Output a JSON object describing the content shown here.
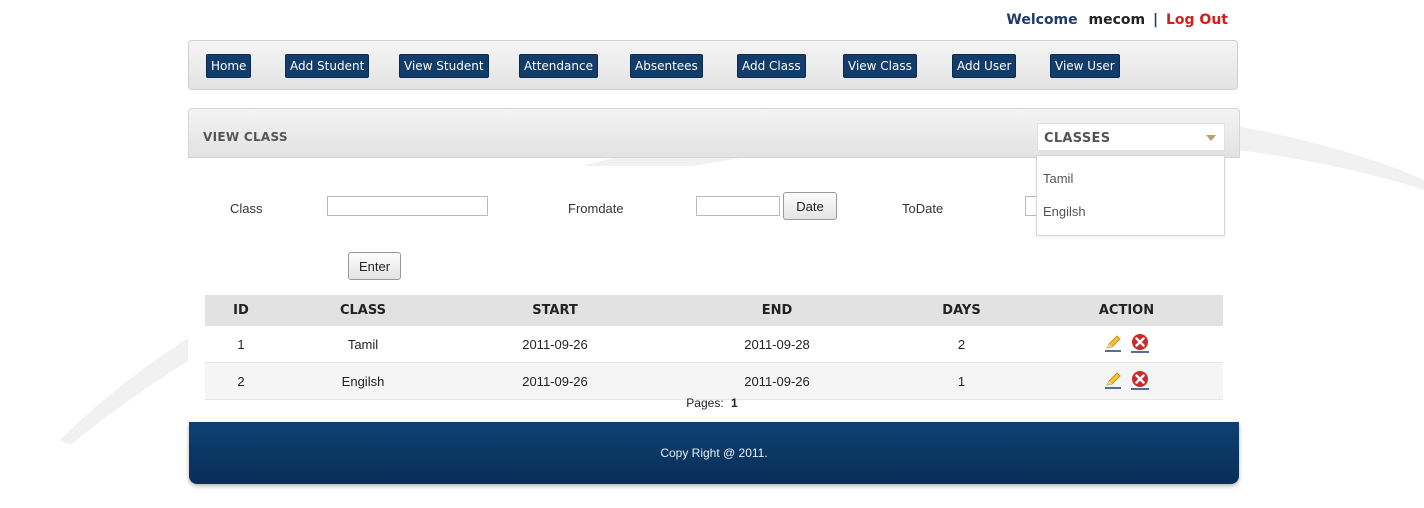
{
  "header": {
    "welcome": "Welcome",
    "user": "mecom",
    "separator": "|",
    "logout": "Log Out"
  },
  "nav": {
    "items": [
      {
        "label": "Home"
      },
      {
        "label": "Add Student"
      },
      {
        "label": "View Student"
      },
      {
        "label": "Attendance"
      },
      {
        "label": "Absentees"
      },
      {
        "label": "Add Class"
      },
      {
        "label": "View Class"
      },
      {
        "label": "Add User"
      },
      {
        "label": "View User"
      }
    ]
  },
  "panel": {
    "title": "VIEW CLASS",
    "dropdown_label": "CLASSES",
    "dropdown_options": [
      "Tamil",
      "Engilsh"
    ]
  },
  "form": {
    "class_label": "Class",
    "class_value": "",
    "fromdate_label": "Fromdate",
    "fromdate_value": "",
    "date_button": "Date",
    "todate_label": "ToDate",
    "todate_value": "",
    "enter_button": "Enter"
  },
  "table": {
    "columns": [
      "ID",
      "CLASS",
      "START",
      "END",
      "DAYS",
      "ACTION"
    ],
    "rows": [
      {
        "id": "1",
        "class": "Tamil",
        "start": "2011-09-26",
        "end": "2011-09-28",
        "days": "2"
      },
      {
        "id": "2",
        "class": "Engilsh",
        "start": "2011-09-26",
        "end": "2011-09-26",
        "days": "1"
      }
    ],
    "action_icons": [
      "pencil-icon",
      "delete-icon"
    ]
  },
  "pagination": {
    "label": "Pages:",
    "current": "1"
  },
  "footer": {
    "text": "Copy Right @ 2011."
  },
  "colors": {
    "nav_button": "#123d6b",
    "footer": "#0b355f",
    "logout": "#d01e1e",
    "delete": "#cc2a2a"
  }
}
